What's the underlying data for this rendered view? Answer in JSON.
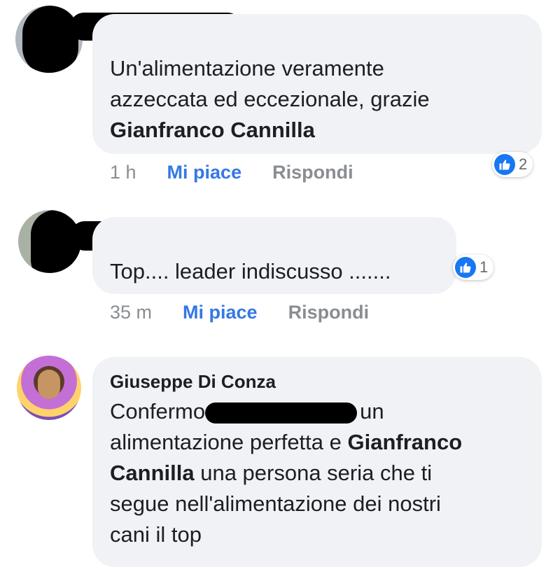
{
  "comments": [
    {
      "text_plain": "Un'alimentazione veramente azzeccata ed eccezionale, grazie ",
      "mention": "Gianfranco Cannilla",
      "line1": "Un'alimentazione veramente",
      "line2": "azzeccata ed eccezionale, grazie",
      "time": "1 h",
      "like_label": "Mi piace",
      "reply_label": "Rispondi",
      "reaction_count": "2"
    },
    {
      "line1": "Top.... leader indiscusso .......",
      "time": "35 m",
      "like_label": "Mi piace",
      "reply_label": "Rispondi",
      "reaction_count": "1"
    },
    {
      "author": "Giuseppe Di Conza",
      "line1_start": "Confermo",
      "line1_end": "un",
      "line2_start": "alimentazione perfetta e ",
      "mention_part1": "Gianfranco",
      "mention_part2": "Cannilla",
      "line3_end": " una persona  seria che ti",
      "line4": "segue nell'alimentazione dei nostri",
      "line5": "cani  il top"
    }
  ],
  "colors": {
    "bubble": "#f0f2f5",
    "like_blue": "#3578e5",
    "reaction_blue": "#1877f2",
    "meta_gray": "#8a8d91"
  }
}
